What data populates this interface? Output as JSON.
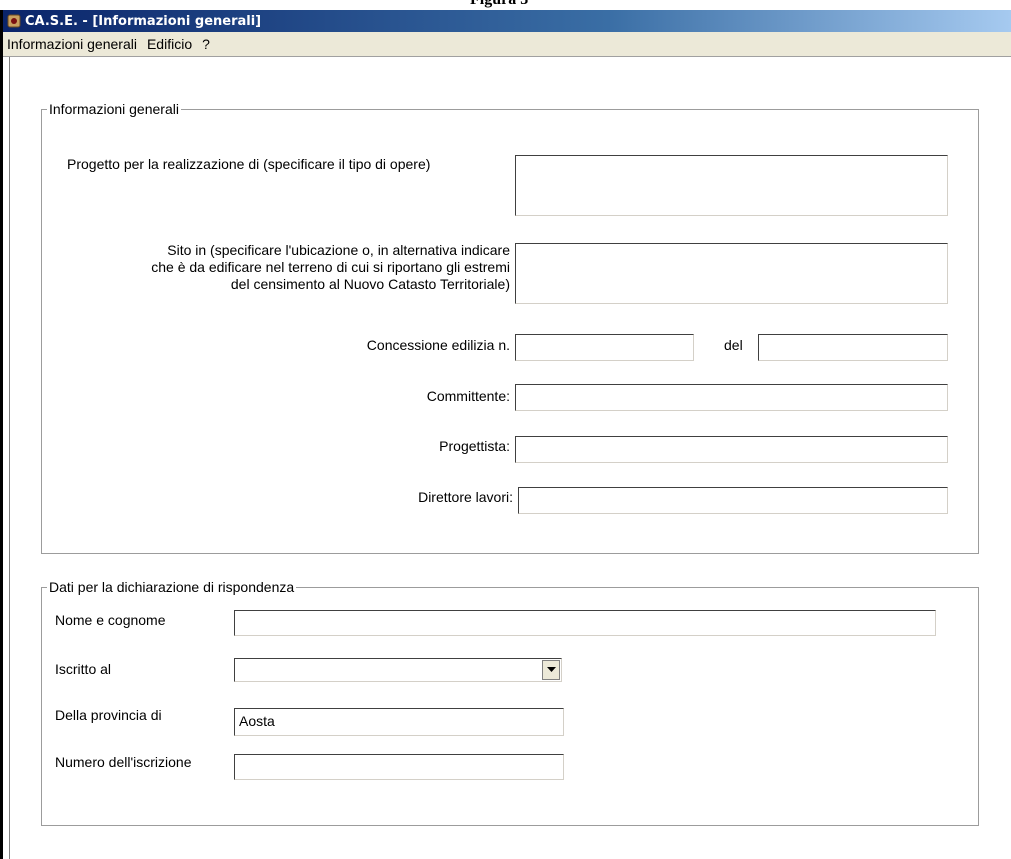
{
  "caption": "Figura 3",
  "window": {
    "title": "CA.S.E. - [Informazioni generali]"
  },
  "menu": [
    "Informazioni generali",
    "Edificio",
    "?"
  ],
  "general": {
    "legend": "Informazioni generali",
    "progetto_label": "Progetto per la realizzazione di (specificare il tipo di opere)",
    "sito_label": [
      "Sito in (specificare l'ubicazione o, in alternativa indicare",
      "che è da edificare nel terreno di cui si riportano gli estremi",
      "del censimento al Nuovo Catasto Territoriale)"
    ],
    "concessione_label": "Concessione edilizia n.",
    "del_label": "del",
    "committente_label": "Committente:",
    "progettista_label": "Progettista:",
    "direttore_label": "Direttore lavori:",
    "progetto_value": "",
    "sito_value": "",
    "concessione_value": "",
    "del_value": "",
    "committente_value": "",
    "progettista_value": "",
    "direttore_value": ""
  },
  "declaration": {
    "legend": "Dati per la dichiarazione di rispondenza",
    "nome_label": "Nome e cognome",
    "iscritto_label": "Iscritto al",
    "provincia_label": "Della provincia di",
    "numero_label": "Numero dell'iscrizione",
    "nome_value": "",
    "iscritto_value": "",
    "provincia_value": "Aosta",
    "numero_value": ""
  }
}
